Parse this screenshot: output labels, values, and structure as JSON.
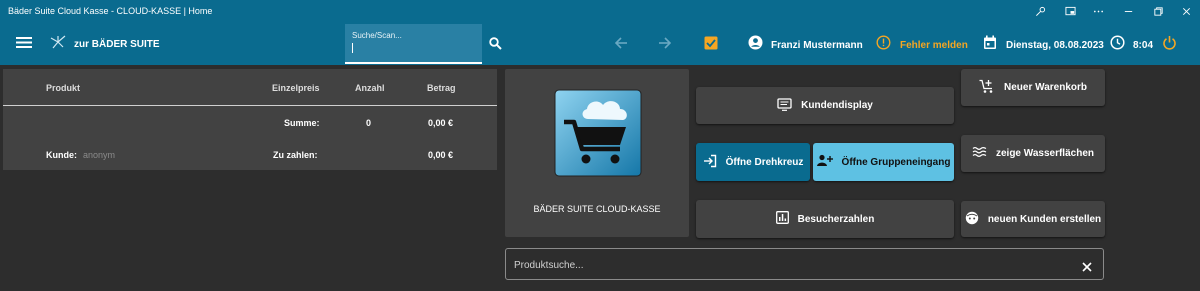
{
  "window": {
    "title": "Bäder Suite Cloud Kasse - CLOUD-KASSE | Home",
    "icons": [
      "key-icon",
      "cast-icon",
      "more-icon",
      "minimize-icon",
      "restore-icon",
      "close-icon"
    ]
  },
  "appbar": {
    "back_label": "zur BÄDER SUITE",
    "search_label": "Suche/Scan...",
    "user_name": "Franzi Mustermann",
    "error_label": "Fehler melden",
    "date": "Dienstag, 08.08.2023",
    "time": "8:04",
    "accent_color": "#f5a623"
  },
  "cart": {
    "columns": [
      "Produkt",
      "Einzelpreis",
      "Anzahl",
      "Betrag"
    ],
    "sum_label": "Summe:",
    "sum_count": "0",
    "sum_amount": "0,00 €",
    "customer_label": "Kunde:",
    "customer_value": "anonym",
    "pay_label": "Zu zahlen:",
    "pay_amount": "0,00 €"
  },
  "brand": {
    "name": "BÄDER SUITE CLOUD-KASSE"
  },
  "actions": {
    "customer_display": "Kundendisplay",
    "turnstile": "Öffne Drehkreuz",
    "group_entrance": "Öffne Gruppeneingang",
    "visitors": "Besucherzahlen",
    "new_cart": "Neuer Warenkorb",
    "water_areas": "zeige Wasserflächen",
    "new_customer": "neuen Kunden erstellen"
  },
  "product_search": {
    "placeholder": "Produktsuche..."
  }
}
